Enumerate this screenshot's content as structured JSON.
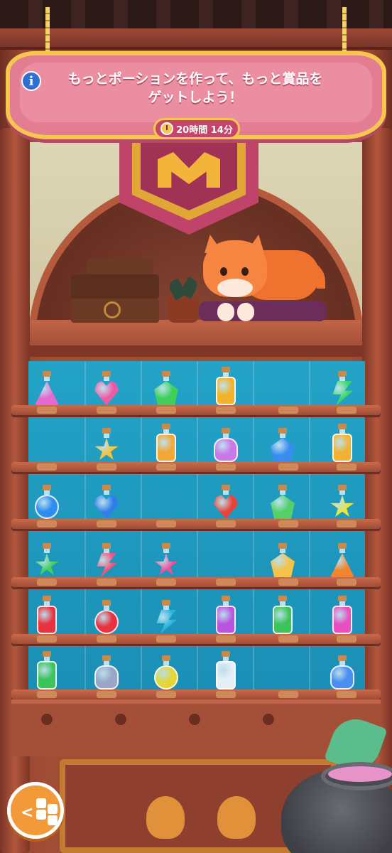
{
  "banner": {
    "message_line1": "もっとポーションを作って、もっと賞品を",
    "message_line2": "ゲットしよう！",
    "timer": "20時間 14分"
  },
  "info_icon": "i",
  "back_button_arrow": "<",
  "colors": {
    "sign_pink": "#e37d92",
    "sign_border": "#f6c74f",
    "shelf_blue": "#23a3c7",
    "wood": "#a04d36",
    "back_button": "#f29a3a"
  },
  "potions": [
    {
      "row": 1,
      "col": 1,
      "shape": "tri",
      "color": "#e56ad0"
    },
    {
      "row": 1,
      "col": 2,
      "shape": "heart",
      "color": "#ef5aa6"
    },
    {
      "row": 1,
      "col": 3,
      "shape": "gem",
      "color": "#3fcf5a"
    },
    {
      "row": 1,
      "col": 4,
      "shape": "tall",
      "color": "#f3b32a"
    },
    {
      "row": 1,
      "col": 6,
      "shape": "bolt",
      "color": "#3dd66b"
    },
    {
      "row": 2,
      "col": 2,
      "shape": "star",
      "color": "#f7c13b"
    },
    {
      "row": 2,
      "col": 3,
      "shape": "tall",
      "color": "#f2a836"
    },
    {
      "row": 2,
      "col": 4,
      "shape": "spiral",
      "color": "#c978e8"
    },
    {
      "row": 2,
      "col": 5,
      "shape": "gem",
      "color": "#3a8cf0"
    },
    {
      "row": 2,
      "col": 6,
      "shape": "tall",
      "color": "#f2b234"
    },
    {
      "row": 3,
      "col": 1,
      "shape": "round",
      "color": "#2f8df2"
    },
    {
      "row": 3,
      "col": 2,
      "shape": "heart",
      "color": "#2f7fe8"
    },
    {
      "row": 3,
      "col": 4,
      "shape": "heart",
      "color": "#e8443a"
    },
    {
      "row": 3,
      "col": 5,
      "shape": "gem",
      "color": "#53d06a"
    },
    {
      "row": 3,
      "col": 6,
      "shape": "star",
      "color": "#e9e63a"
    },
    {
      "row": 4,
      "col": 1,
      "shape": "star",
      "color": "#3fcf5a"
    },
    {
      "row": 4,
      "col": 2,
      "shape": "bolt",
      "color": "#f0567b"
    },
    {
      "row": 4,
      "col": 3,
      "shape": "star",
      "color": "#ee4f9a"
    },
    {
      "row": 4,
      "col": 5,
      "shape": "gem",
      "color": "#f3c34a"
    },
    {
      "row": 4,
      "col": 6,
      "shape": "tri",
      "color": "#f3852f"
    },
    {
      "row": 5,
      "col": 1,
      "shape": "tall",
      "color": "#e8323f"
    },
    {
      "row": 5,
      "col": 2,
      "shape": "round",
      "color": "#e8323f"
    },
    {
      "row": 5,
      "col": 3,
      "shape": "bolt",
      "color": "#2bb3e0"
    },
    {
      "row": 5,
      "col": 4,
      "shape": "tall",
      "color": "#b954e0"
    },
    {
      "row": 5,
      "col": 5,
      "shape": "tall",
      "color": "#3cc45a"
    },
    {
      "row": 5,
      "col": 6,
      "shape": "tall",
      "color": "#ea4fc0"
    },
    {
      "row": 6,
      "col": 1,
      "shape": "tall",
      "color": "#3cc45a"
    },
    {
      "row": 6,
      "col": 2,
      "shape": "spiral",
      "color": "#9aa6c8"
    },
    {
      "row": 6,
      "col": 3,
      "shape": "round",
      "color": "#e3d63a"
    },
    {
      "row": 6,
      "col": 4,
      "shape": "tall",
      "color": "#e6eef6"
    },
    {
      "row": 6,
      "col": 6,
      "shape": "spiral",
      "color": "#4a8ff0"
    }
  ]
}
